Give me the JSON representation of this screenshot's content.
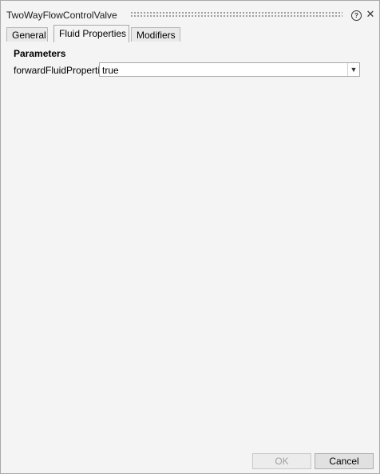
{
  "window": {
    "title": "TwoWayFlowControlValve",
    "help_icon": "help-icon",
    "close_icon": "close-icon"
  },
  "tabs": [
    {
      "label": "General",
      "active": false
    },
    {
      "label": "Fluid Properties",
      "active": true
    },
    {
      "label": "Modifiers",
      "active": false
    }
  ],
  "parameters": {
    "section_title": "Parameters",
    "items": [
      {
        "label": "forwardFluidProperties",
        "value": "true"
      }
    ]
  },
  "buttons": {
    "ok_label": "OK",
    "cancel_label": "Cancel"
  }
}
